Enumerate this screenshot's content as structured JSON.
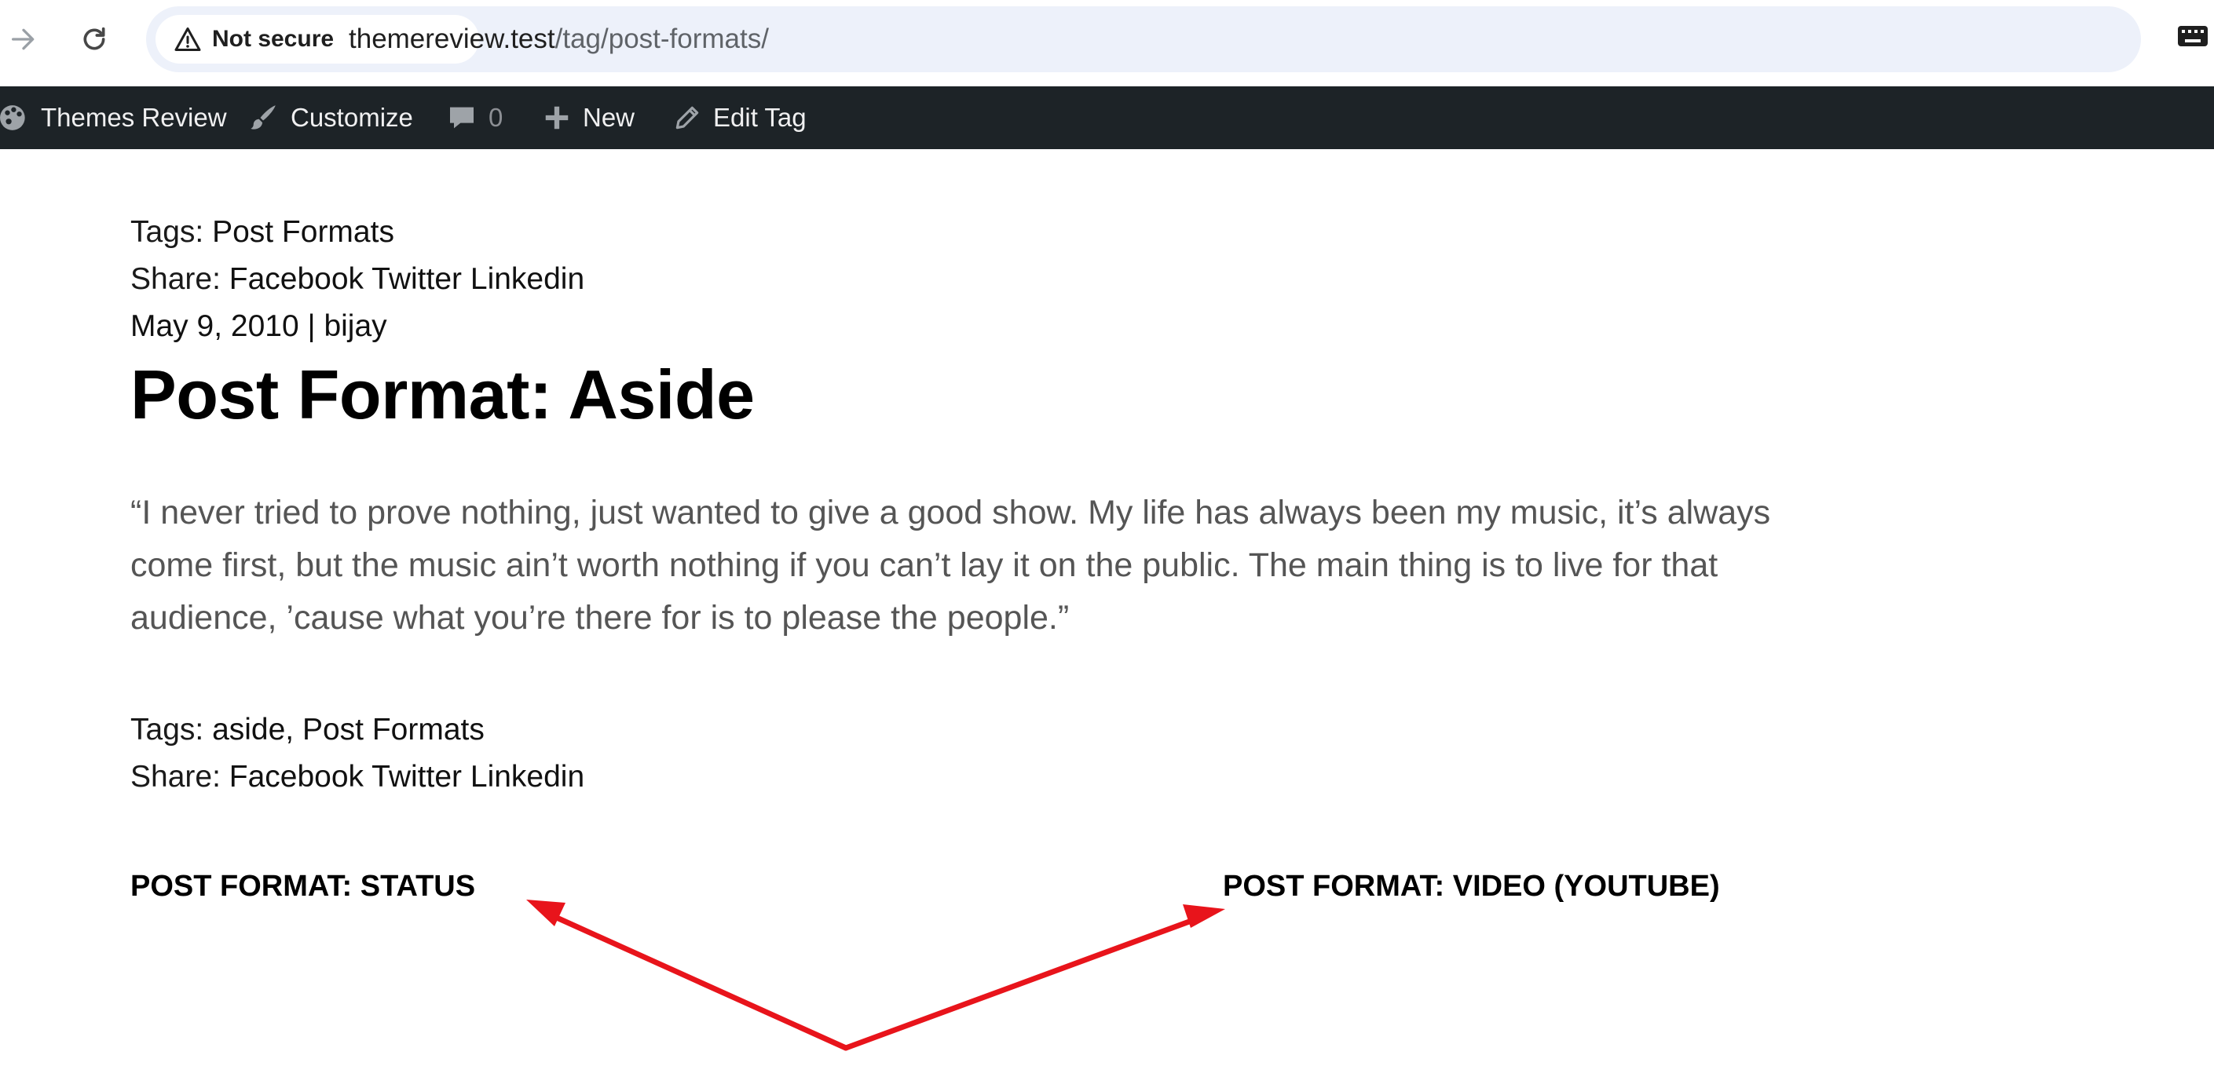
{
  "browser": {
    "security_label": "Not secure",
    "url_host": "themereview.test",
    "url_path": "/tag/post-formats/"
  },
  "admin_bar": {
    "site_name": "Themes Review",
    "customize": "Customize",
    "comments_count": "0",
    "new": "New",
    "edit_tag": "Edit Tag"
  },
  "top_meta": {
    "tags_label": "Tags: ",
    "tags": "Post Formats",
    "share_label": "Share: ",
    "share_links": [
      "Facebook",
      "Twitter",
      "Linkedin"
    ]
  },
  "post": {
    "date": "May 9, 2010",
    "separator": " | ",
    "author": "bijay",
    "title": "Post Format: Aside",
    "quote": "“I never tried to prove nothing, just wanted to give a good show. My life has always been my music, it’s always come first, but the music ain’t worth nothing if you can’t lay it on the public. The main thing is to live for that audience, ’cause what you’re there for is to please the people.”",
    "tags_label": "Tags: ",
    "tags": [
      "aside",
      "Post Formats"
    ],
    "tags_separator": ", ",
    "share_label": "Share: ",
    "share_links": [
      "Facebook",
      "Twitter",
      "Linkedin"
    ]
  },
  "related": {
    "left": "POST FORMAT: STATUS",
    "right": "POST FORMAT: VIDEO (YOUTUBE)"
  },
  "colors": {
    "admin_bar_bg": "#1d2327",
    "annotation_arrow": "#e8141b",
    "omnibox_bg": "#edf1fa"
  }
}
